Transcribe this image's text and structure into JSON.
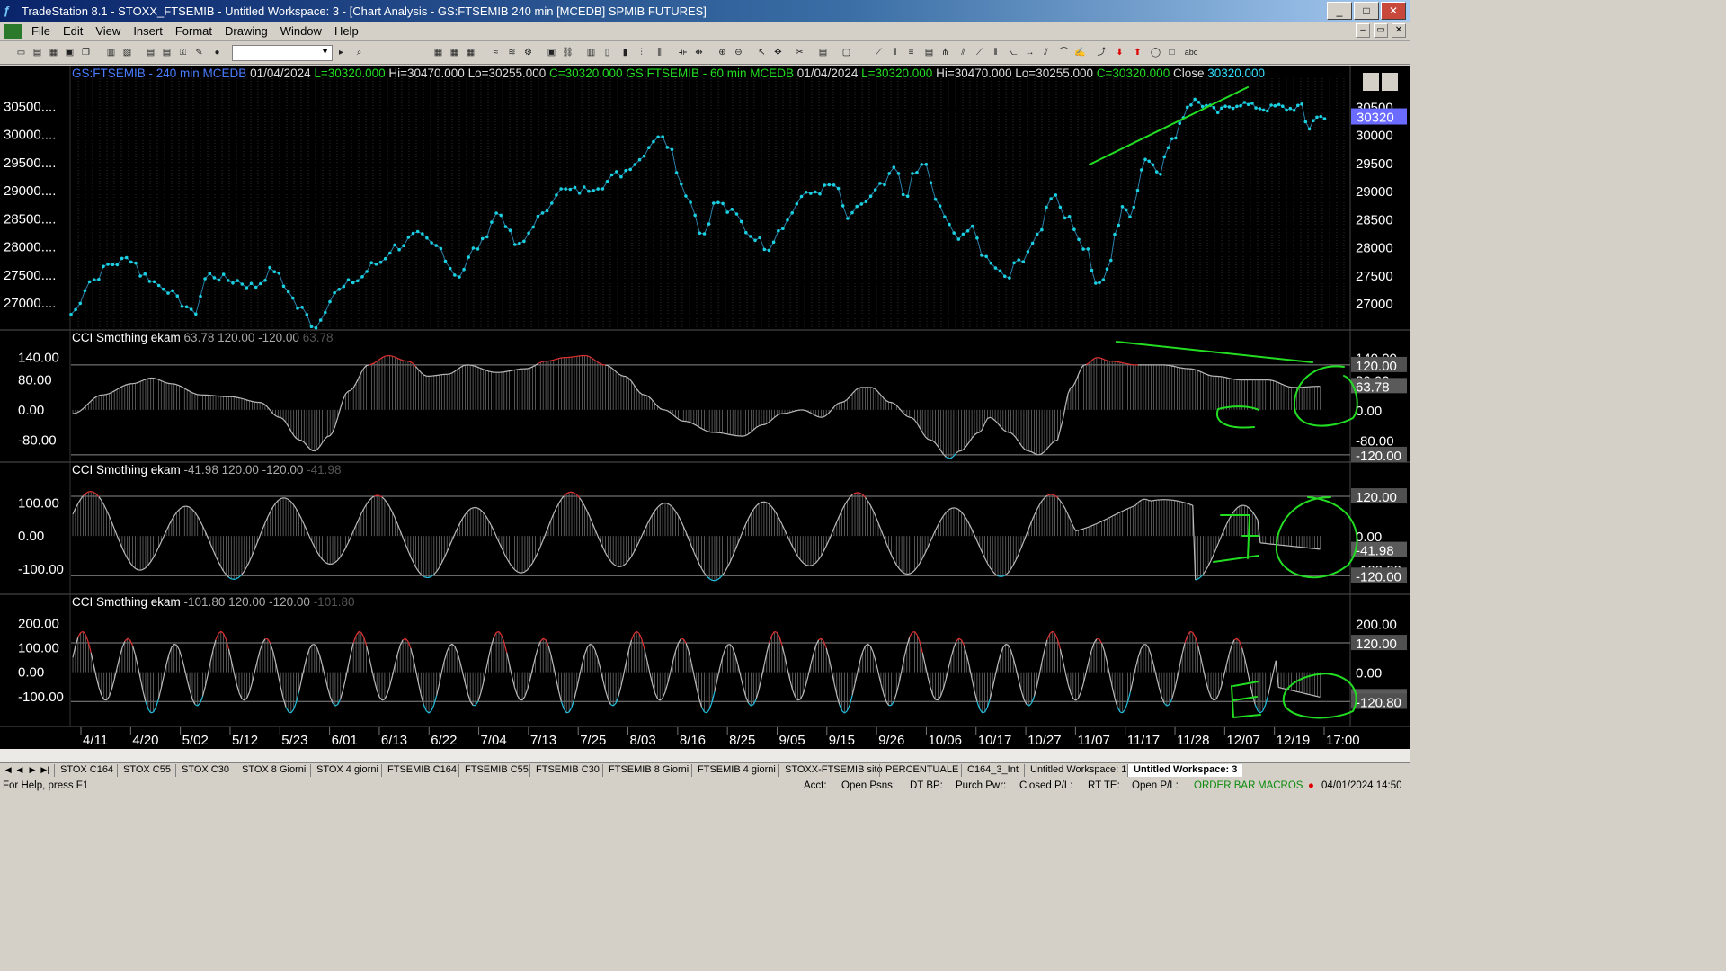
{
  "window": {
    "title": "TradeStation 8.1 - STOXX_FTSEMIB - Untitled Workspace:  3 - [Chart Analysis - GS:FTSEMIB  240 min  [MCEDB] SPMIB FUTURES]",
    "minimize": "_",
    "maximize": "□",
    "close": "✕"
  },
  "menu": [
    "File",
    "Edit",
    "View",
    "Insert",
    "Format",
    "Drawing",
    "Window",
    "Help"
  ],
  "mdi_controls": [
    "–",
    "▭",
    "✕"
  ],
  "header_text": {
    "symbol1": "GS:FTSEMIB - 240 min",
    "feed1": "MCEDB",
    "date1": "01/04/2024",
    "last1": "L=30320.000",
    "hi1": "Hi=30470.000",
    "lo1": "Lo=30255.000",
    "close1": "C=30320.000",
    "symbol2": "GS:FTSEMIB - 60 min",
    "feed2": "MCEDB",
    "date2": "01/04/2024",
    "last2": "L=30320.000",
    "hi2": "Hi=30470.000",
    "lo2": "Lo=30255.000",
    "close2": "C=30320.000",
    "close_label": "Close",
    "close_value": "30320.000"
  },
  "chart_data": [
    {
      "type": "line",
      "panel": "price",
      "left_ticks": [
        "30500....",
        "30000....",
        "29500....",
        "29000....",
        "28500....",
        "28000....",
        "27500....",
        "27000...."
      ],
      "right_ticks": [
        "30500",
        "30000",
        "29500",
        "29000",
        "28500",
        "28000",
        "27500",
        "27000"
      ],
      "tick_values": [
        30500,
        30000,
        29500,
        29000,
        28500,
        28000,
        27500,
        27000
      ],
      "last_label": "30320",
      "ylim": [
        26650,
        31000
      ],
      "x_labels": [
        "4/11",
        "4/20",
        "5/02",
        "5/12",
        "5/23",
        "6/01",
        "6/13",
        "6/22",
        "7/04",
        "7/13",
        "7/25",
        "8/03",
        "8/16",
        "8/25",
        "9/05",
        "9/15",
        "9/26",
        "10/06",
        "10/17",
        "10/27",
        "11/07",
        "11/17",
        "11/28",
        "12/07",
        "12/19",
        "17:00"
      ],
      "keypoints": [
        [
          0,
          26800
        ],
        [
          0.02,
          27400
        ],
        [
          0.04,
          27700
        ],
        [
          0.06,
          27800
        ],
        [
          0.07,
          27500
        ],
        [
          0.09,
          27300
        ],
        [
          0.11,
          27000
        ],
        [
          0.12,
          26800
        ],
        [
          0.135,
          27500
        ],
        [
          0.16,
          27400
        ],
        [
          0.18,
          27300
        ],
        [
          0.2,
          27600
        ],
        [
          0.21,
          27300
        ],
        [
          0.225,
          26900
        ],
        [
          0.24,
          26600
        ],
        [
          0.26,
          27200
        ],
        [
          0.28,
          27400
        ],
        [
          0.3,
          27700
        ],
        [
          0.32,
          28000
        ],
        [
          0.34,
          28200
        ],
        [
          0.36,
          28000
        ],
        [
          0.38,
          27500
        ],
        [
          0.4,
          28000
        ],
        [
          0.42,
          28600
        ],
        [
          0.44,
          28000
        ],
        [
          0.46,
          28500
        ],
        [
          0.48,
          29000
        ],
        [
          0.5,
          29000
        ],
        [
          0.52,
          29100
        ],
        [
          0.54,
          29300
        ],
        [
          0.555,
          29500
        ],
        [
          0.57,
          29800
        ],
        [
          0.575,
          30000
        ],
        [
          0.59,
          29800
        ],
        [
          0.6,
          29100
        ],
        [
          0.61,
          28800
        ],
        [
          0.62,
          28200
        ],
        [
          0.635,
          28800
        ],
        [
          0.65,
          28600
        ],
        [
          0.67,
          28200
        ],
        [
          0.685,
          28000
        ],
        [
          0.7,
          28400
        ],
        [
          0.72,
          28900
        ],
        [
          0.735,
          29000
        ],
        [
          0.75,
          29100
        ],
        [
          0.765,
          28500
        ],
        [
          0.78,
          28800
        ],
        [
          0.8,
          29100
        ],
        [
          0.81,
          29400
        ],
        [
          0.82,
          28900
        ],
        [
          0.83,
          29300
        ],
        [
          0.84,
          29500
        ],
        [
          0.85,
          28800
        ],
        [
          0.87,
          28200
        ],
        [
          0.885,
          28300
        ],
        [
          0.9,
          27800
        ],
        [
          0.92,
          27500
        ],
        [
          0.935,
          27800
        ],
        [
          0.95,
          28200
        ],
        [
          0.965,
          28900
        ],
        [
          0.98,
          28500
        ],
        [
          1.0,
          27900
        ]
      ],
      "keypoints2": [
        [
          0,
          27800
        ],
        [
          0.03,
          27400
        ],
        [
          0.06,
          27400
        ],
        [
          0.09,
          27700
        ],
        [
          0.12,
          28300
        ],
        [
          0.15,
          28800
        ],
        [
          0.18,
          28500
        ],
        [
          0.21,
          29000
        ],
        [
          0.24,
          29600
        ],
        [
          0.27,
          29500
        ],
        [
          0.3,
          29300
        ],
        [
          0.33,
          29700
        ],
        [
          0.36,
          29900
        ],
        [
          0.39,
          30200
        ],
        [
          0.42,
          30500
        ],
        [
          0.45,
          30600
        ],
        [
          0.5,
          30500
        ],
        [
          0.55,
          30400
        ],
        [
          0.6,
          30500
        ],
        [
          0.65,
          30550
        ],
        [
          0.7,
          30500
        ],
        [
          0.75,
          30450
        ],
        [
          0.8,
          30500
        ],
        [
          0.85,
          30450
        ],
        [
          0.9,
          30500
        ],
        [
          0.93,
          30100
        ],
        [
          0.96,
          30300
        ],
        [
          1.0,
          30320
        ]
      ]
    },
    {
      "type": "bar",
      "panel": "cci1",
      "name": "CCI Smothing ekam",
      "value": "63.78",
      "upper": "120.00",
      "lower": "-120.00",
      "value_dim": "63.78",
      "left_ticks": [
        "140.00",
        "80.00",
        "0.00",
        "-80.00"
      ],
      "tick_values": [
        140,
        80,
        0,
        -80
      ],
      "right_labels": [
        "140.00",
        "120.00",
        "80.00",
        "63.78",
        "0.00",
        "-80.00",
        "-120.00"
      ],
      "right_values": [
        140,
        120,
        80,
        63.78,
        0,
        -80,
        -120
      ],
      "ylim": [
        -125,
        175
      ],
      "levels": [
        120,
        -120
      ],
      "keypoints": [
        [
          0,
          -10
        ],
        [
          0.03,
          40
        ],
        [
          0.06,
          70
        ],
        [
          0.08,
          85
        ],
        [
          0.1,
          70
        ],
        [
          0.13,
          40
        ],
        [
          0.16,
          35
        ],
        [
          0.19,
          20
        ],
        [
          0.21,
          -20
        ],
        [
          0.23,
          -80
        ],
        [
          0.245,
          -110
        ],
        [
          0.26,
          -70
        ],
        [
          0.28,
          50
        ],
        [
          0.3,
          120
        ],
        [
          0.32,
          145
        ],
        [
          0.34,
          130
        ],
        [
          0.36,
          90
        ],
        [
          0.38,
          95
        ],
        [
          0.4,
          120
        ],
        [
          0.43,
          100
        ],
        [
          0.46,
          110
        ],
        [
          0.48,
          130
        ],
        [
          0.5,
          140
        ],
        [
          0.52,
          145
        ],
        [
          0.54,
          120
        ],
        [
          0.56,
          90
        ],
        [
          0.58,
          40
        ],
        [
          0.6,
          0
        ],
        [
          0.62,
          -30
        ],
        [
          0.65,
          -60
        ],
        [
          0.68,
          -70
        ],
        [
          0.7,
          -40
        ],
        [
          0.72,
          -10
        ],
        [
          0.74,
          0
        ],
        [
          0.76,
          -20
        ],
        [
          0.78,
          20
        ],
        [
          0.8,
          60
        ],
        [
          0.81,
          60
        ],
        [
          0.83,
          20
        ],
        [
          0.85,
          -20
        ],
        [
          0.87,
          -80
        ],
        [
          0.89,
          -130
        ],
        [
          0.9,
          -110
        ],
        [
          0.92,
          -60
        ],
        [
          0.93,
          -20
        ],
        [
          0.95,
          -60
        ],
        [
          0.97,
          -110
        ],
        [
          0.98,
          -120
        ],
        [
          1.0,
          -80
        ]
      ],
      "keypoints2": [
        [
          0,
          -60
        ],
        [
          0.05,
          60
        ],
        [
          0.1,
          120
        ],
        [
          0.15,
          140
        ],
        [
          0.2,
          130
        ],
        [
          0.3,
          120
        ],
        [
          0.4,
          120
        ],
        [
          0.5,
          110
        ],
        [
          0.6,
          90
        ],
        [
          0.7,
          80
        ],
        [
          0.8,
          80
        ],
        [
          0.9,
          60
        ],
        [
          1.0,
          63
        ]
      ]
    },
    {
      "type": "bar",
      "panel": "cci2",
      "name": "CCI Smothing ekam",
      "value": "-41.98",
      "upper": "120.00",
      "lower": "-120.00",
      "value_dim": "-41.98",
      "left_ticks": [
        "100.00",
        "0.00",
        "-100.00"
      ],
      "tick_values": [
        100,
        0,
        -100
      ],
      "right_labels": [
        "120.00",
        "0.00",
        "-41.98",
        "-100.00",
        "-120.00"
      ],
      "right_values": [
        120,
        0,
        -41.98,
        -100,
        -120
      ],
      "ylim": [
        -160,
        180
      ]
    },
    {
      "type": "bar",
      "panel": "cci3",
      "name": "CCI Smothing ekam",
      "value": "-101.80",
      "upper": "120.00",
      "lower": "-120.00",
      "value_dim": "-101.80",
      "left_ticks": [
        "200.00",
        "100.00",
        "0.00",
        "-100.00"
      ],
      "tick_values": [
        200,
        100,
        0,
        -100
      ],
      "right_labels": [
        "200.00",
        "120.00",
        "0.00",
        "-101.80",
        "-120.80"
      ],
      "right_values": [
        200,
        120,
        0,
        -101.8,
        -120.8
      ],
      "ylim": [
        -200,
        260
      ]
    }
  ],
  "tabs": [
    "STOX C164",
    "STOX C55",
    "STOX  C30",
    "STOX  8 Giorni",
    "STOX 4 giorni",
    "FTSEMIB C164",
    "FTSEMIB C55",
    "FTSEMIB C30",
    "FTSEMIB  8 Giorni",
    "FTSEMIB  4 giorni",
    "STOXX-FTSEMIB sito",
    "PERCENTUALE",
    "C164_3_Int",
    "Untitled Workspace:  1",
    "Untitled Workspace:  3"
  ],
  "tab_nav": [
    "|◀",
    "◀",
    "▶",
    "▶|"
  ],
  "status": {
    "help": "For Help, press F1",
    "acct": "Acct:",
    "open_psns": "Open Psns:",
    "dt_bp": "DT BP:",
    "purch_pwr": "Purch Pwr:",
    "closed_pl": "Closed P/L:",
    "rt_te": "RT TE:",
    "open_pl": "Open P/L:",
    "order_bar": "ORDER BAR",
    "macros": "MACROS",
    "datetime": "04/01/2024 14:50"
  },
  "colors": {
    "price": "#1ad0e0",
    "up": "#e03030",
    "down": "#20c0e0",
    "annotation": "#22dd22",
    "header_blue": "#4a7cff",
    "header_green": "#22dd22",
    "last_price_bg": "#6b6bff"
  }
}
